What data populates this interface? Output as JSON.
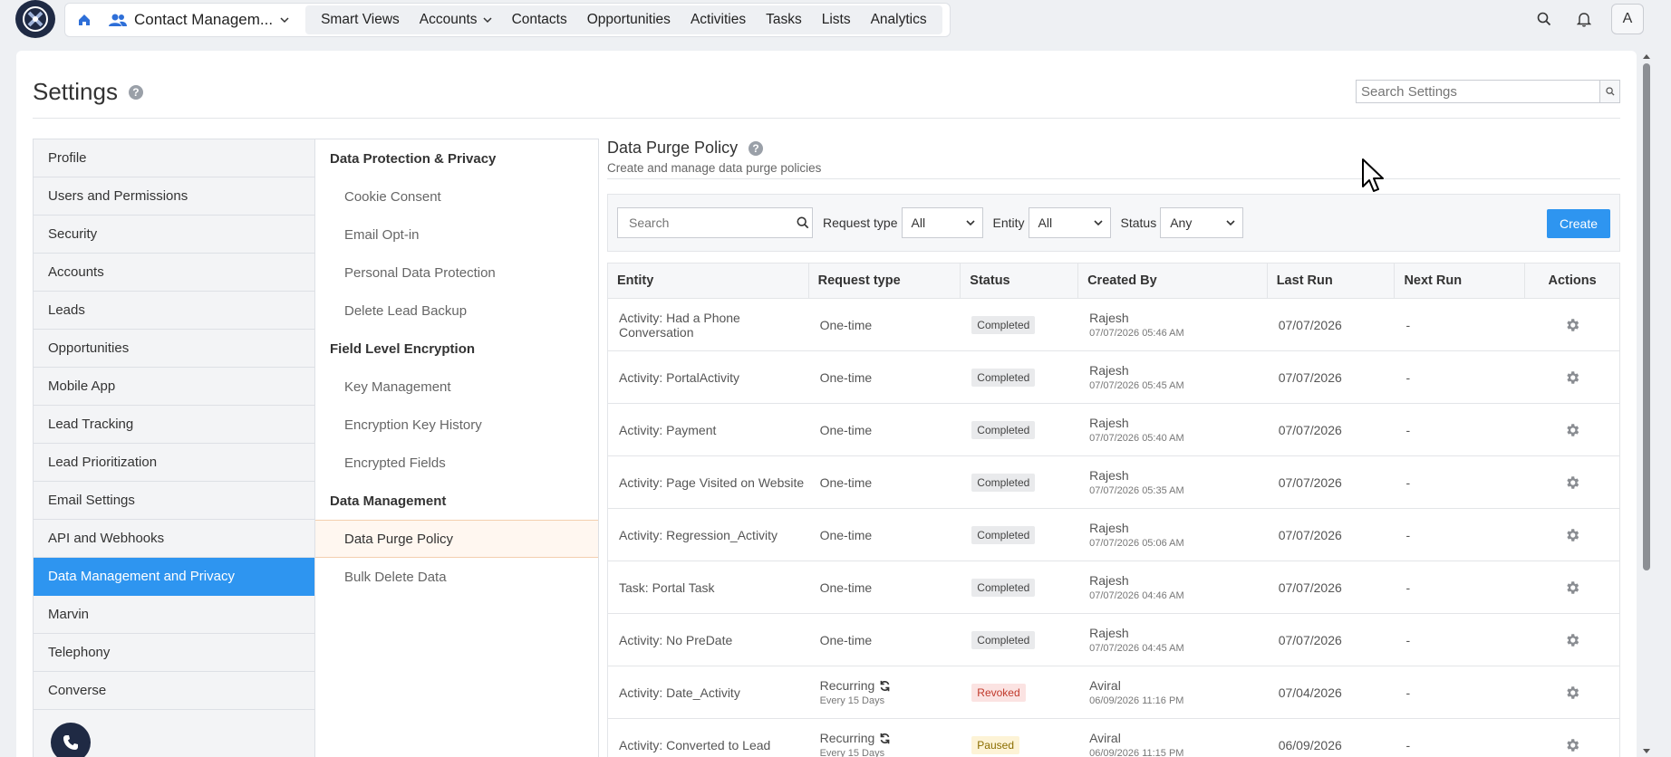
{
  "topnav": {
    "app_name": "Contact Managem...",
    "items": [
      "Smart Views",
      "Accounts",
      "Contacts",
      "Opportunities",
      "Activities",
      "Tasks",
      "Lists",
      "Analytics"
    ],
    "avatar_initial": "A"
  },
  "settings": {
    "title": "Settings",
    "search_placeholder": "Search Settings"
  },
  "left_nav": [
    "Profile",
    "Users and Permissions",
    "Security",
    "Accounts",
    "Leads",
    "Opportunities",
    "Mobile App",
    "Lead Tracking",
    "Lead Prioritization",
    "Email Settings",
    "API and Webhooks",
    "Data Management and Privacy",
    "Marvin",
    "Telephony",
    "Converse"
  ],
  "left_nav_active": "Data Management and Privacy",
  "sub_nav": {
    "section1": "Data Protection & Privacy",
    "section1_items": [
      "Cookie Consent",
      "Email Opt-in",
      "Personal Data Protection",
      "Delete Lead Backup"
    ],
    "section2": "Field Level Encryption",
    "section2_items": [
      "Key Management",
      "Encryption Key History",
      "Encrypted Fields"
    ],
    "section3": "Data Management",
    "section3_items": [
      "Data Purge Policy",
      "Bulk Delete Data"
    ]
  },
  "content": {
    "title": "Data Purge Policy",
    "subtitle": "Create and manage data purge policies"
  },
  "filters": {
    "search_placeholder": "Search",
    "request_type_label": "Request type",
    "request_type_value": "All",
    "entity_label": "Entity",
    "entity_value": "All",
    "status_label": "Status",
    "status_value": "Any",
    "create_label": "Create"
  },
  "table": {
    "headers": [
      "Entity",
      "Request type",
      "Status",
      "Created By",
      "Last Run",
      "Next Run",
      "Actions"
    ],
    "rows": [
      {
        "entity": "Activity: Had a Phone Conversation",
        "type": "One-time",
        "freq": "",
        "status": "Completed",
        "by": "Rajesh",
        "at": "07/07/2026 05:46 AM",
        "last": "07/07/2026",
        "next": "-"
      },
      {
        "entity": "Activity: PortalActivity",
        "type": "One-time",
        "freq": "",
        "status": "Completed",
        "by": "Rajesh",
        "at": "07/07/2026 05:45 AM",
        "last": "07/07/2026",
        "next": "-"
      },
      {
        "entity": "Activity: Payment",
        "type": "One-time",
        "freq": "",
        "status": "Completed",
        "by": "Rajesh",
        "at": "07/07/2026 05:40 AM",
        "last": "07/07/2026",
        "next": "-"
      },
      {
        "entity": "Activity: Page Visited on Website",
        "type": "One-time",
        "freq": "",
        "status": "Completed",
        "by": "Rajesh",
        "at": "07/07/2026 05:35 AM",
        "last": "07/07/2026",
        "next": "-"
      },
      {
        "entity": "Activity: Regression_Activity",
        "type": "One-time",
        "freq": "",
        "status": "Completed",
        "by": "Rajesh",
        "at": "07/07/2026 05:06 AM",
        "last": "07/07/2026",
        "next": "-"
      },
      {
        "entity": "Task: Portal Task",
        "type": "One-time",
        "freq": "",
        "status": "Completed",
        "by": "Rajesh",
        "at": "07/07/2026 04:46 AM",
        "last": "07/07/2026",
        "next": "-"
      },
      {
        "entity": "Activity: No PreDate",
        "type": "One-time",
        "freq": "",
        "status": "Completed",
        "by": "Rajesh",
        "at": "07/07/2026 04:45 AM",
        "last": "07/07/2026",
        "next": "-"
      },
      {
        "entity": "Activity: Date_Activity",
        "type": "Recurring",
        "freq": "Every 15 Days",
        "status": "Revoked",
        "by": "Aviral",
        "at": "06/09/2026 11:16 PM",
        "last": "07/04/2026",
        "next": "-"
      },
      {
        "entity": "Activity: Converted to Lead",
        "type": "Recurring",
        "freq": "Every 15 Days",
        "status": "Paused",
        "by": "Aviral",
        "at": "06/09/2026 11:15 PM",
        "last": "06/09/2026",
        "next": "-"
      }
    ]
  },
  "colors": {
    "primary": "#2e95f0",
    "dark": "#1f2a44"
  }
}
